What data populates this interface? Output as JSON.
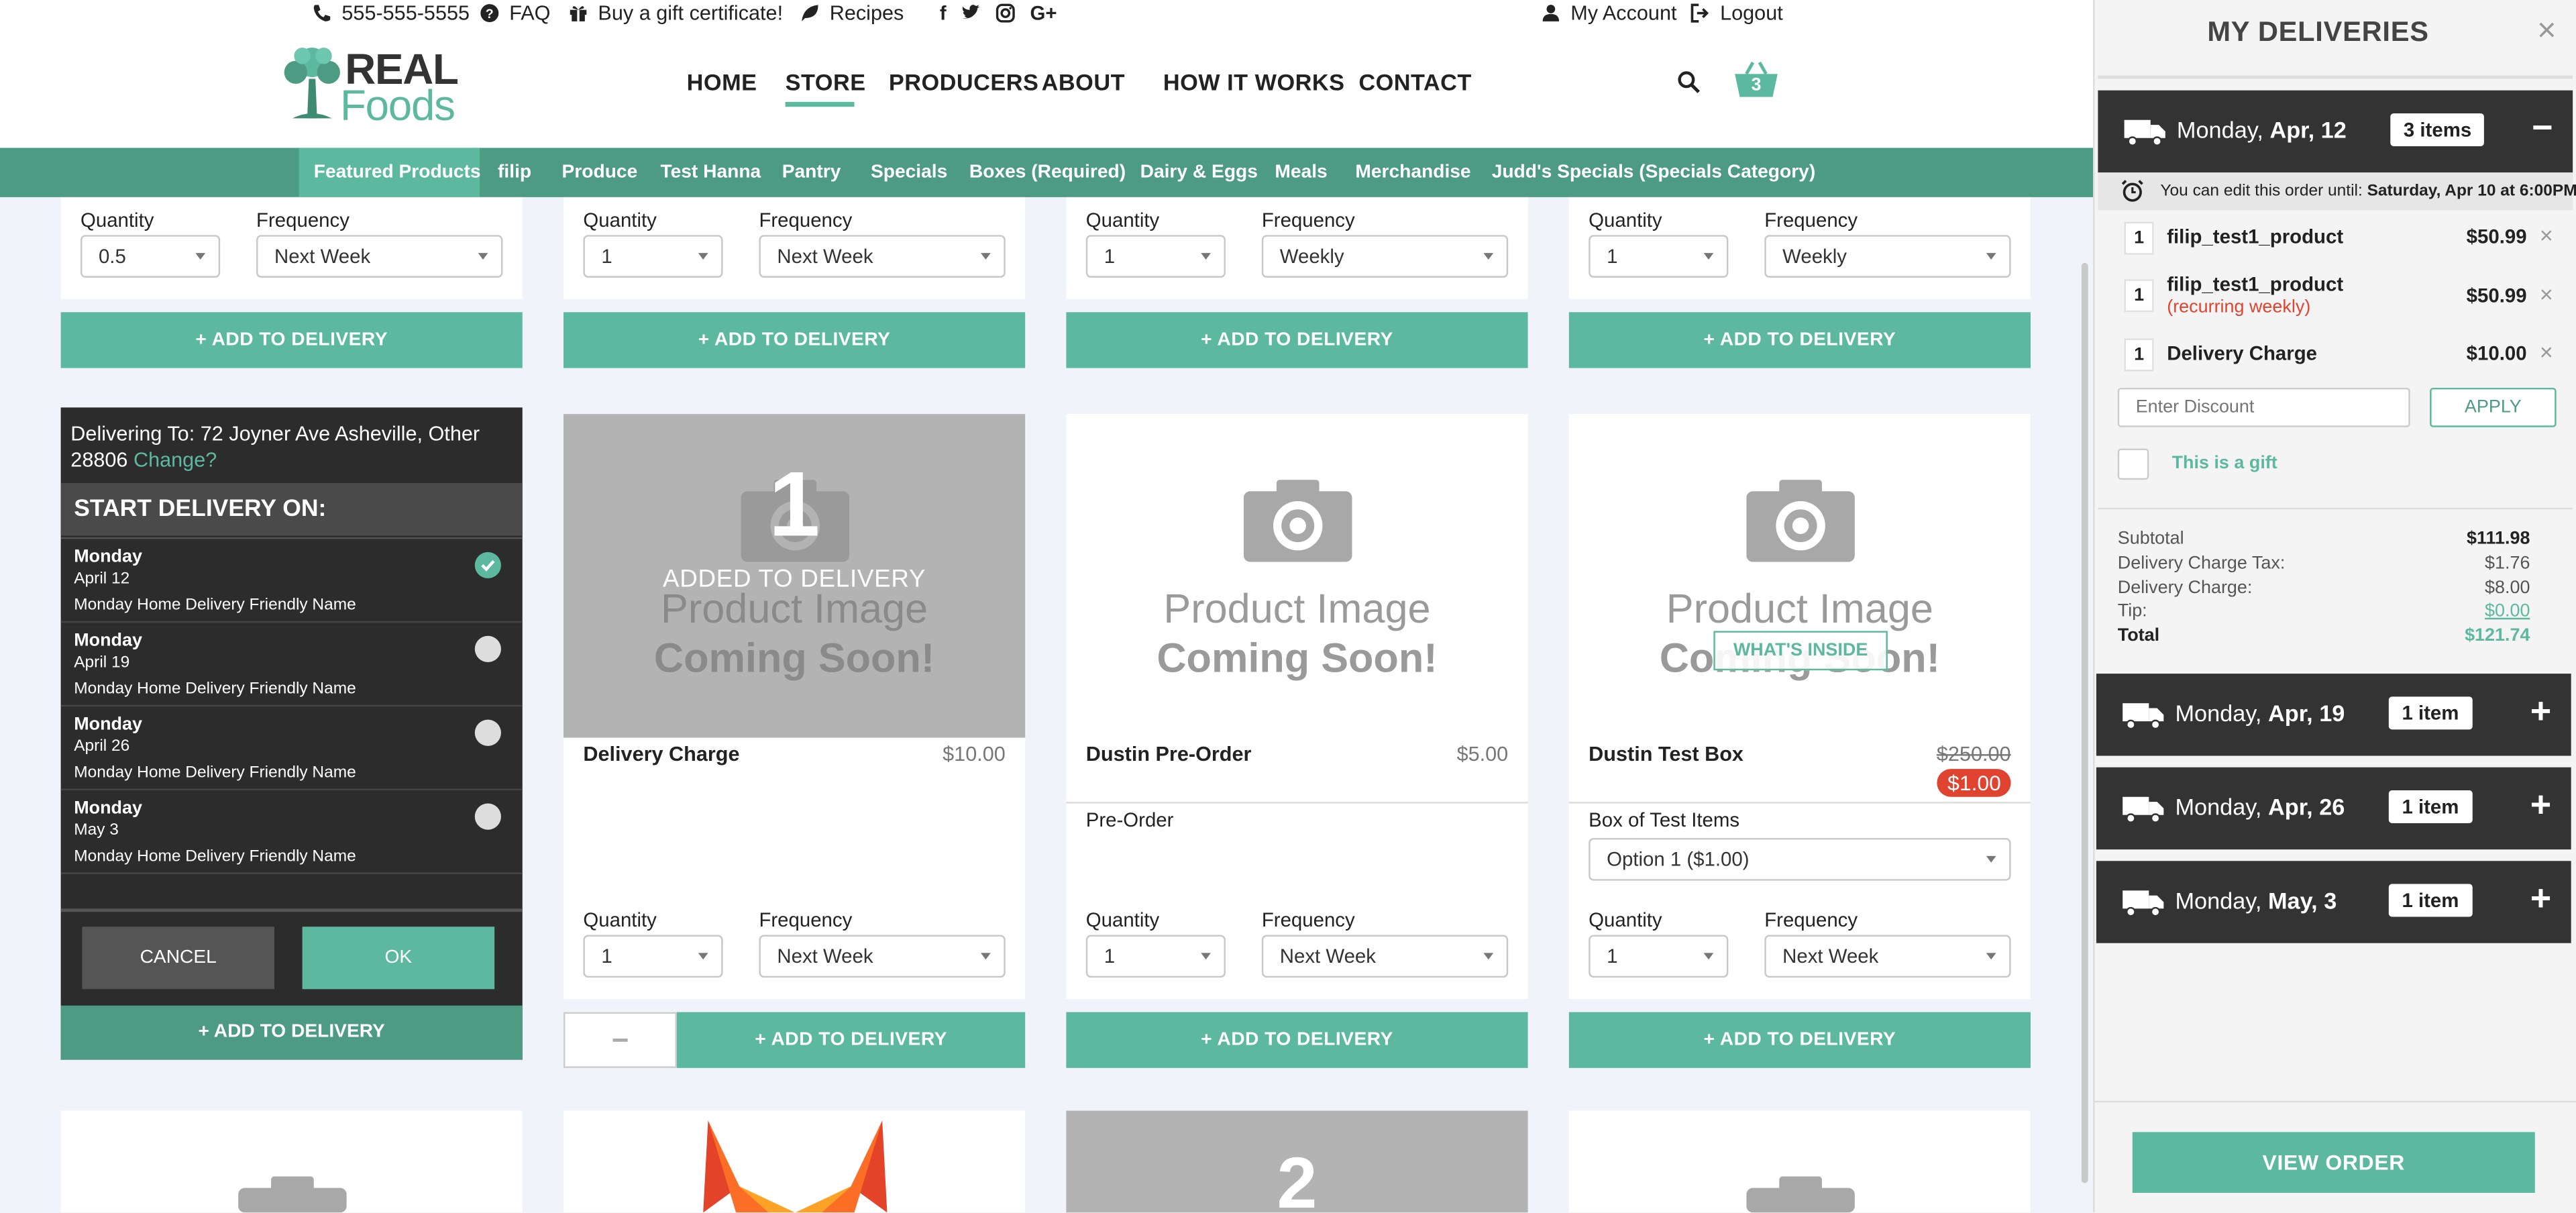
{
  "topbar": {
    "phone": "555-555-5555",
    "faq": "FAQ",
    "gift": "Buy a gift certificate!",
    "recipes": "Recipes",
    "account": "My Account",
    "logout": "Logout"
  },
  "logo": {
    "line1": "REAL",
    "line2": "Foods"
  },
  "nav": {
    "items": [
      "HOME",
      "STORE",
      "PRODUCERS",
      "ABOUT",
      "HOW IT WORKS",
      "CONTACT"
    ],
    "active": "STORE"
  },
  "cart": {
    "count": "3"
  },
  "categories": [
    "Featured Products",
    "filip",
    "Produce",
    "Test Hanna",
    "Pantry",
    "Specials",
    "Boxes (Required)",
    "Dairy & Eggs",
    "Meals",
    "Merchandise",
    "Judd's Specials (Specials Category)"
  ],
  "labels": {
    "quantity": "Quantity",
    "frequency": "Frequency",
    "add_to_delivery": "ADD TO DELIVERY",
    "placeholder_1": "Product Image",
    "placeholder_2": "Coming Soon!"
  },
  "row1": [
    {
      "quantity": "0.5",
      "frequency": "Next Week"
    },
    {
      "quantity": "1",
      "frequency": "Next Week"
    },
    {
      "quantity": "1",
      "frequency": "Weekly"
    },
    {
      "quantity": "1",
      "frequency": "Weekly"
    }
  ],
  "row2": {
    "delivery_charge": {
      "badge_num": "1",
      "badge_text": "ADDED TO DELIVERY",
      "name": "Delivery Charge",
      "price": "$10.00",
      "quantity": "1",
      "frequency": "Next Week",
      "minus": "−"
    },
    "preorder": {
      "name": "Dustin Pre-Order",
      "price": "$5.00",
      "desc": "Pre-Order",
      "quantity": "1",
      "frequency": "Next Week"
    },
    "testbox": {
      "name": "Dustin Test Box",
      "old_price": "$250.00",
      "price": "$1.00",
      "whats_inside": "WHAT'S INSIDE",
      "option_label": "Box of Test Items",
      "option": "Option 1 ($1.00)",
      "quantity": "1",
      "frequency": "Next Week"
    }
  },
  "row3": {
    "badge_num": "2"
  },
  "overlay": {
    "delivering_to": "Delivering To: 72 Joyner Ave Asheville, Other 28806",
    "change": "Change?",
    "title": "START DELIVERY ON:",
    "options": [
      {
        "day": "Monday",
        "date": "April 12",
        "name": "Monday Home Delivery Friendly Name",
        "selected": true
      },
      {
        "day": "Monday",
        "date": "April 19",
        "name": "Monday Home Delivery Friendly Name",
        "selected": false
      },
      {
        "day": "Monday",
        "date": "April 26",
        "name": "Monday Home Delivery Friendly Name",
        "selected": false
      },
      {
        "day": "Monday",
        "date": "May 3",
        "name": "Monday Home Delivery Friendly Name",
        "selected": false
      }
    ],
    "cancel": "CANCEL",
    "ok": "OK",
    "add": "ADD TO DELIVERY"
  },
  "sidebar": {
    "title": "MY DELIVERIES",
    "close": "×",
    "deliveries": [
      {
        "day": "Monday,",
        "date": "Apr, 12",
        "count": "3 items",
        "toggle": "−"
      },
      {
        "day": "Monday,",
        "date": "Apr, 19",
        "count": "1 item",
        "toggle": "+"
      },
      {
        "day": "Monday,",
        "date": "Apr, 26",
        "count": "1 item",
        "toggle": "+"
      },
      {
        "day": "Monday,",
        "date": "May, 3",
        "count": "1 item",
        "toggle": "+"
      }
    ],
    "edit_note": "You can edit this order until:",
    "edit_until": "Saturday, Apr 10 at 6:00PM",
    "items": [
      {
        "qty": "1",
        "name": "filip_test1_product",
        "note": "",
        "price": "$50.99"
      },
      {
        "qty": "1",
        "name": "filip_test1_product",
        "note": "(recurring weekly)",
        "price": "$50.99"
      },
      {
        "qty": "1",
        "name": "Delivery Charge",
        "note": "",
        "price": "$10.00"
      }
    ],
    "discount_placeholder": "Enter Discount",
    "apply": "APPLY",
    "gift": "This is a gift",
    "summary": {
      "subtotal_label": "Subtotal",
      "subtotal": "$111.98",
      "tax_label": "Delivery Charge Tax:",
      "tax": "$1.76",
      "charge_label": "Delivery Charge:",
      "charge": "$8.00",
      "tip_label": "Tip:",
      "tip": "$0.00",
      "total_label": "Total",
      "total": "$121.74"
    },
    "view_order": "VIEW ORDER"
  },
  "colors": {
    "accent": "#5cb99f",
    "nav_bar": "#4e9b84",
    "dark": "#333333",
    "danger": "#e0432f"
  }
}
